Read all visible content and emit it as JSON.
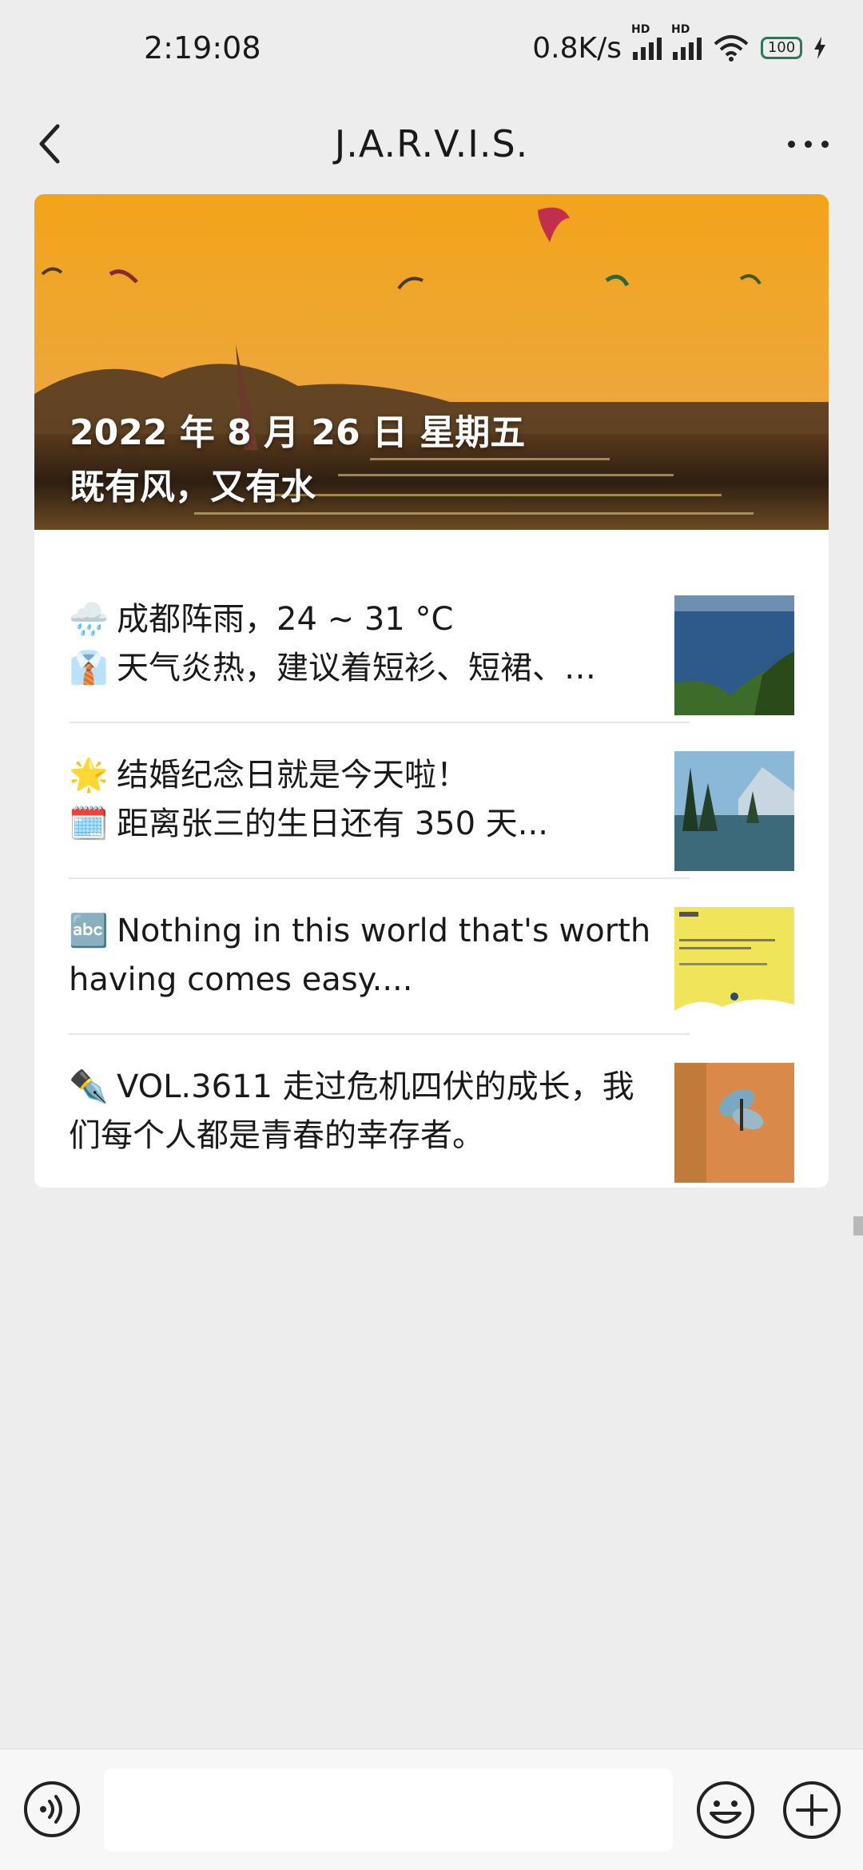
{
  "status_bar": {
    "time": "2:19:08",
    "net_speed": "0.8K/s",
    "hd_label": "HD",
    "battery": "100"
  },
  "nav": {
    "title": "J.A.R.V.I.S."
  },
  "hero": {
    "date": "2022 年 8 月 26 日  星期五",
    "slogan": "既有风，又有水"
  },
  "items": [
    {
      "lines": [
        {
          "emoji": "🌧️",
          "text": "成都阵雨，24 ~ 31 °C"
        },
        {
          "emoji": "👔",
          "text": "天气炎热，建议着短衫、短裙、…"
        }
      ]
    },
    {
      "lines": [
        {
          "emoji": "🌟",
          "text": "结婚纪念日就是今天啦！"
        },
        {
          "emoji": "🗓️",
          "text": "距离张三的生日还有 350 天..."
        }
      ]
    },
    {
      "lines": [
        {
          "emoji": "🔤",
          "text": "Nothing in this world that's worth"
        },
        {
          "emoji": "",
          "text": "having comes easy...."
        }
      ]
    },
    {
      "lines": [
        {
          "emoji": "✒️",
          "text": "VOL.3611 走过危机四伏的成长，我"
        },
        {
          "emoji": "",
          "text": "们每个人都是青春的幸存者。"
        }
      ]
    }
  ],
  "input": {
    "placeholder": ""
  },
  "colors": {
    "background": "#ededed",
    "card": "#ffffff",
    "hero_orange": "#f2a21c"
  }
}
